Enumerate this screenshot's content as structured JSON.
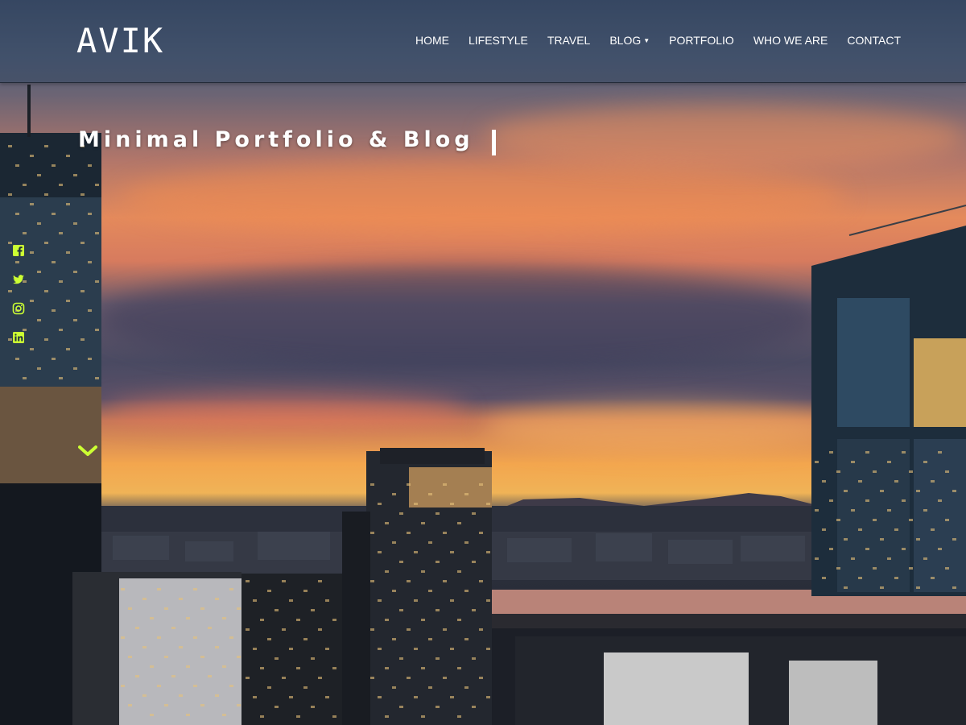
{
  "site": {
    "logo": "AVIK",
    "accent_color": "#ccff33"
  },
  "nav": {
    "items": [
      {
        "label": "HOME",
        "name": "nav-home",
        "dropdown": false
      },
      {
        "label": "LIFESTYLE",
        "name": "nav-lifestyle",
        "dropdown": false
      },
      {
        "label": "TRAVEL",
        "name": "nav-travel",
        "dropdown": false
      },
      {
        "label": "BLOG",
        "name": "nav-blog",
        "dropdown": true
      },
      {
        "label": "PORTFOLIO",
        "name": "nav-portfolio",
        "dropdown": false
      },
      {
        "label": "WHO WE ARE",
        "name": "nav-who-we-are",
        "dropdown": false
      },
      {
        "label": "CONTACT",
        "name": "nav-contact",
        "dropdown": false
      }
    ]
  },
  "hero": {
    "title": "Minimal Portfolio & Blog",
    "background": "city skyline at sunset"
  },
  "social": [
    {
      "icon": "facebook-icon"
    },
    {
      "icon": "twitter-icon"
    },
    {
      "icon": "instagram-icon"
    },
    {
      "icon": "linkedin-icon"
    }
  ],
  "scroll": {
    "icon": "chevron-down-icon"
  }
}
